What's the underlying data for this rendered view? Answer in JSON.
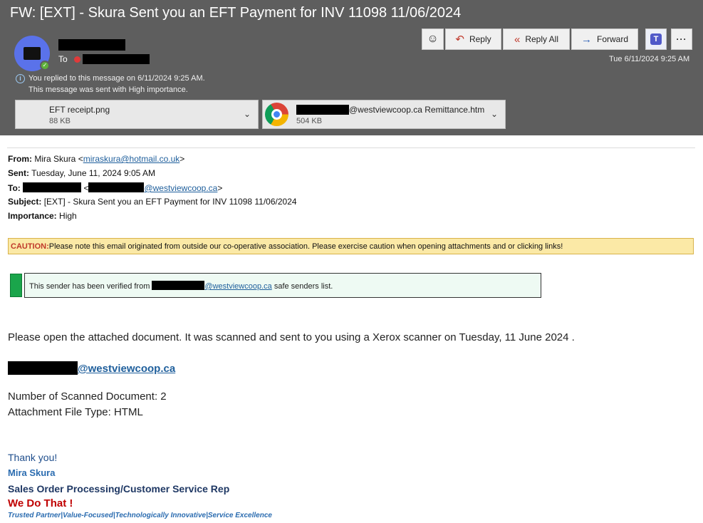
{
  "header": {
    "subject": "FW: [EXT] - Skura Sent you an EFT Payment for INV 11098 11/06/2024",
    "to_label": "To",
    "info_replied": "You replied to this message on 6/11/2024 9:25 AM.",
    "info_importance": "This message was sent with High importance.",
    "date": "Tue 6/11/2024 9:25 AM",
    "actions": {
      "emoji_icon": "smiley-icon",
      "reply": "Reply",
      "reply_all": "Reply All",
      "forward": "Forward",
      "teams_icon": "teams-icon",
      "more": "···"
    },
    "attachments": [
      {
        "name": "EFT receipt.png",
        "size": "88 KB",
        "icon": "image-file-icon"
      },
      {
        "name": "@westviewcoop.ca Remittance.htm",
        "size": "504 KB",
        "icon": "chrome-icon"
      }
    ]
  },
  "body": {
    "from_label": "From:",
    "from_name": "Mira Skura <",
    "from_email": "miraskura@hotmail.co.uk",
    "from_end": ">",
    "sent_label": "Sent:",
    "sent_value": "Tuesday, June 11, 2024 9:05 AM",
    "to_label": "To:",
    "to_email": "@westviewcoop.ca",
    "subject_label": "Subject:",
    "subject_value": "[EXT] - Skura Sent you an EFT Payment for INV 11098 11/06/2024",
    "importance_label": "Importance:",
    "importance_value": "High",
    "caution_label": "CAUTION:",
    "caution_text": "Please note this email originated from outside our co-operative association. Please exercise caution when opening attachments and or clicking links!",
    "verified_pre": "This sender has been verified from",
    "verified_link": "@westviewcoop.ca",
    "verified_post": "safe senders list.",
    "paragraph": "Please open the attached document. It was scanned and sent to you using a Xerox scanner on Tuesday, 11 June 2024 .",
    "sender_domain": "@westviewcoop.ca",
    "scanned_count": "Number of Scanned Document: 2",
    "file_type": "Attachment File Type: HTML",
    "thanks": "Thank you!",
    "sig_name": "Mira Skura",
    "sig_title": "Sales Order Processing/Customer Service Rep",
    "sig_slogan": "We Do That !",
    "sig_tagline": "Trusted Partner|Value-Focused|Technologically Innovative|Service Excellence"
  }
}
